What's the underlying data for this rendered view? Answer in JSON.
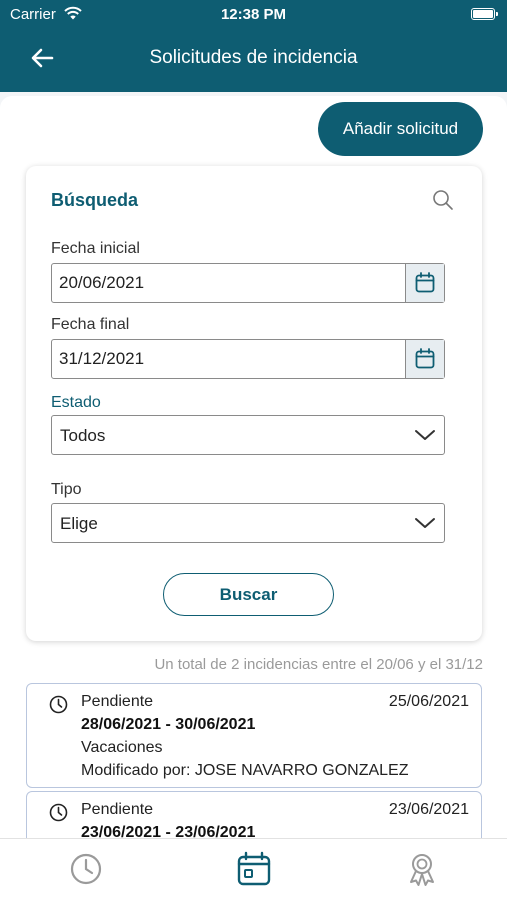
{
  "status_bar": {
    "carrier": "Carrier",
    "time": "12:38 PM"
  },
  "header": {
    "title": "Solicitudes de incidencia",
    "back_icon": "arrow-left-icon"
  },
  "actions": {
    "add_label": "Añadir solicitud"
  },
  "search": {
    "title": "Búsqueda",
    "fecha_inicial_label": "Fecha inicial",
    "fecha_inicial_value": "20/06/2021",
    "fecha_final_label": "Fecha final",
    "fecha_final_value": "31/12/2021",
    "estado_label": "Estado",
    "estado_value": "Todos",
    "tipo_label": "Tipo",
    "tipo_value": "Elige",
    "buscar_label": "Buscar"
  },
  "summary": "Un total de 2 incidencias entre el 20/06 y el 31/12",
  "results": [
    {
      "status": "Pendiente",
      "date": "25/06/2021",
      "range": "28/06/2021 - 30/06/2021",
      "type": "Vacaciones",
      "modified": "Modificado por: JOSE NAVARRO GONZALEZ"
    },
    {
      "status": "Pendiente",
      "date": "23/06/2021",
      "range": "23/06/2021 - 23/06/2021"
    }
  ],
  "tabbar": {
    "items": [
      "clock-icon",
      "calendar-icon",
      "award-icon"
    ],
    "active": "calendar-icon"
  },
  "colors": {
    "primary": "#0e5d72",
    "muted": "#9a9a9a",
    "tab_inactive": "#9a9a9a"
  }
}
